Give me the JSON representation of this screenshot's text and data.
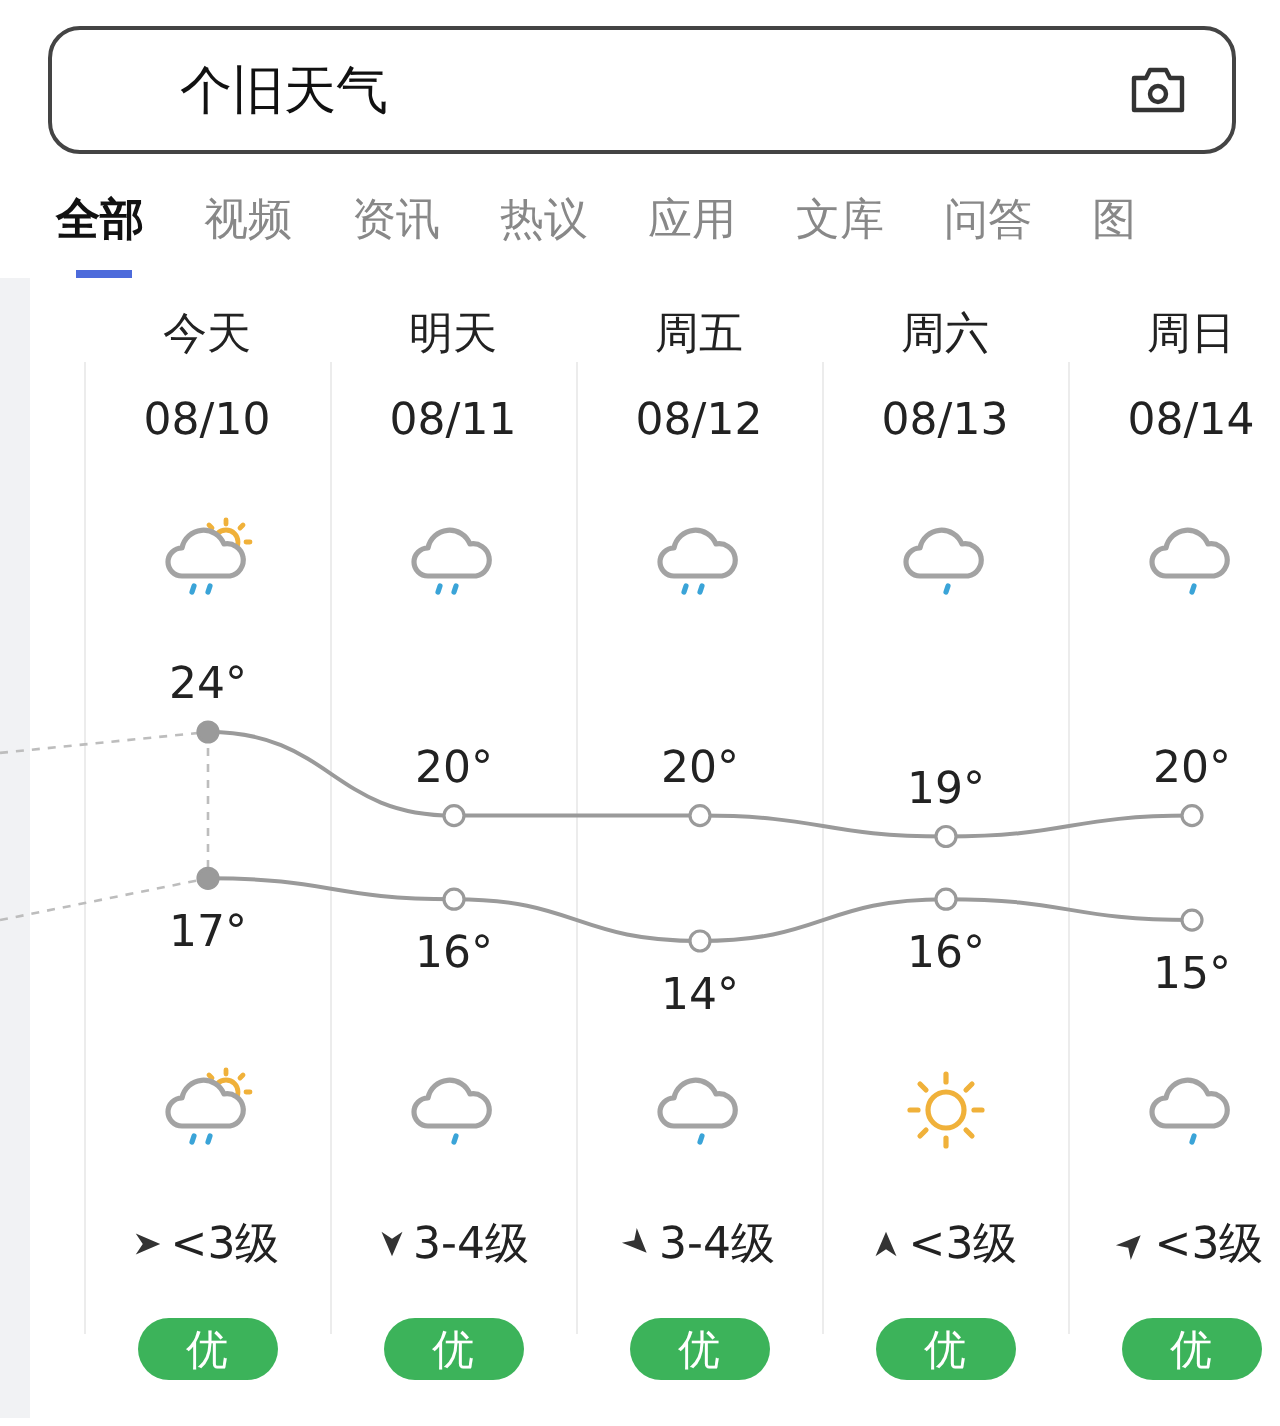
{
  "search": {
    "value": "个旧天气"
  },
  "tabs": [
    {
      "label": "全部",
      "selected": true
    },
    {
      "label": "视频",
      "selected": false
    },
    {
      "label": "资讯",
      "selected": false
    },
    {
      "label": "热议",
      "selected": false
    },
    {
      "label": "应用",
      "selected": false
    },
    {
      "label": "文库",
      "selected": false
    },
    {
      "label": "问答",
      "selected": false
    },
    {
      "label": "图",
      "selected": false
    }
  ],
  "days": [
    {
      "name": "今天",
      "date": "08/10",
      "day_weather": {
        "kind": "sun-cloud-rain"
      },
      "night_weather": {
        "kind": "sun-cloud-rain"
      },
      "wind_arrow": {
        "kind": "east"
      },
      "wind": "<3级",
      "aqi": {
        "label": "优",
        "color": "#3cb35a"
      }
    },
    {
      "name": "明天",
      "date": "08/11",
      "day_weather": {
        "kind": "rain"
      },
      "night_weather": {
        "kind": "light-rain"
      },
      "wind_arrow": {
        "kind": "south"
      },
      "wind": "3-4级",
      "aqi": {
        "label": "优",
        "color": "#3cb35a"
      }
    },
    {
      "name": "周五",
      "date": "08/12",
      "day_weather": {
        "kind": "rain"
      },
      "night_weather": {
        "kind": "light-rain"
      },
      "wind_arrow": {
        "kind": "southeast"
      },
      "wind": "3-4级",
      "aqi": {
        "label": "优",
        "color": "#3cb35a"
      }
    },
    {
      "name": "周六",
      "date": "08/13",
      "day_weather": {
        "kind": "light-rain"
      },
      "night_weather": {
        "kind": "sun"
      },
      "wind_arrow": {
        "kind": "north"
      },
      "wind": "<3级",
      "aqi": {
        "label": "优",
        "color": "#3cb35a"
      }
    },
    {
      "name": "周日",
      "date": "08/14",
      "day_weather": {
        "kind": "light-rain"
      },
      "night_weather": {
        "kind": "light-rain"
      },
      "wind_arrow": {
        "kind": "northeast"
      },
      "wind": "<3级",
      "aqi": {
        "label": "优",
        "color": "#3cb35a"
      }
    }
  ],
  "chart_data": {
    "type": "line",
    "series": [
      {
        "color": "#9a9a9a",
        "marker": "circle",
        "values": [
          24,
          20,
          20,
          19,
          20
        ],
        "value_labels": [
          "24°",
          "20°",
          "20°",
          "19°",
          "20°"
        ]
      },
      {
        "color": "#9a9a9a",
        "marker": "circle",
        "values": [
          17,
          16,
          14,
          16,
          15
        ],
        "value_labels": [
          "17°",
          "16°",
          "14°",
          "16°",
          "15°"
        ]
      }
    ],
    "data_labels": true
  }
}
